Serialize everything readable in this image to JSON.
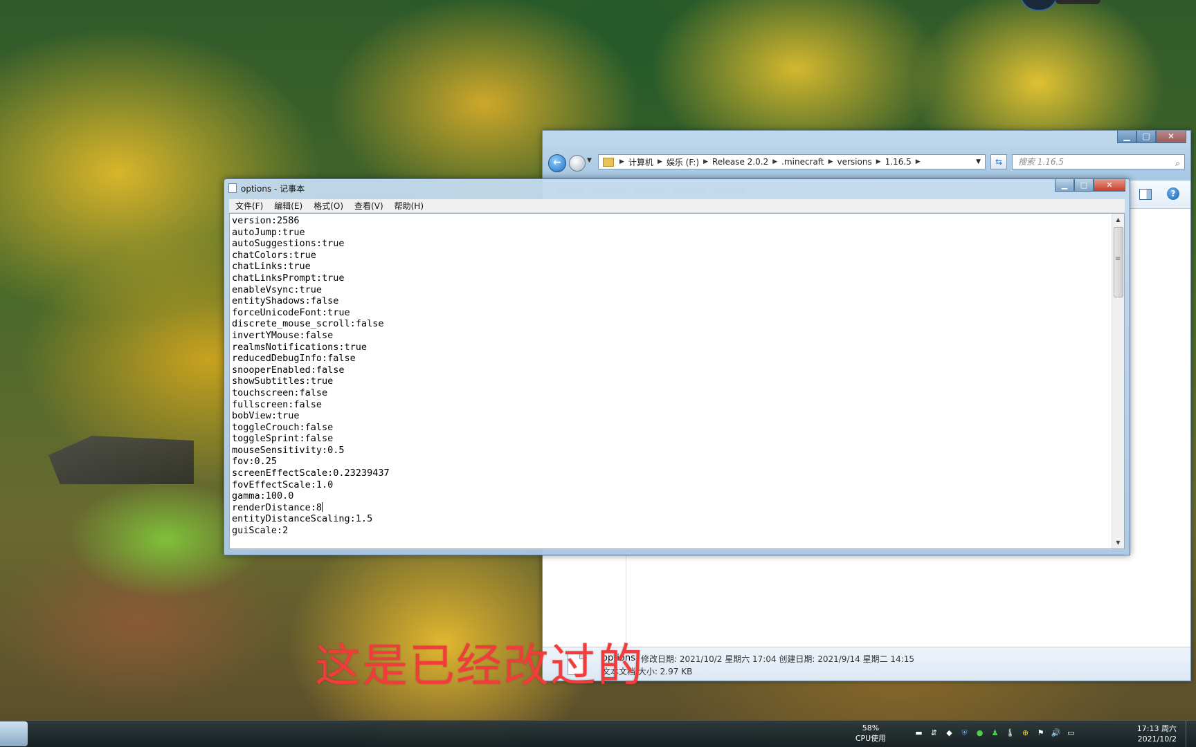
{
  "explorer": {
    "window_controls": {
      "minimize": "▁",
      "maximize": "□",
      "close": "✕"
    },
    "breadcrumb": [
      "计算机",
      "娱乐 (F:)",
      "Release 2.0.2",
      ".minecraft",
      "versions",
      "1.16.5"
    ],
    "search_placeholder": "搜索 1.16.5",
    "details": {
      "filename": "options",
      "modified": "修改日期: 2021/10/2 星期六 17:04 创建日期: 2021/9/14 星期二 14:15",
      "type_size": "文本文档    大小: 2.97 KB"
    }
  },
  "notepad": {
    "title": "options - 记事本",
    "window_controls": {
      "minimize": "▁",
      "maximize": "□",
      "close": "✕"
    },
    "menu": [
      "文件(F)",
      "编辑(E)",
      "格式(O)",
      "查看(V)",
      "帮助(H)"
    ],
    "lines": [
      "version:2586",
      "autoJump:true",
      "autoSuggestions:true",
      "chatColors:true",
      "chatLinks:true",
      "chatLinksPrompt:true",
      "enableVsync:true",
      "entityShadows:false",
      "forceUnicodeFont:true",
      "discrete_mouse_scroll:false",
      "invertYMouse:false",
      "realmsNotifications:true",
      "reducedDebugInfo:false",
      "snooperEnabled:false",
      "showSubtitles:true",
      "touchscreen:false",
      "fullscreen:false",
      "bobView:true",
      "toggleCrouch:false",
      "toggleSprint:false",
      "mouseSensitivity:0.5",
      "fov:0.25",
      "screenEffectScale:0.23239437",
      "fovEffectScale:1.0",
      "gamma:100.0",
      "renderDistance:8",
      "entityDistanceScaling:1.5",
      "guiScale:2"
    ]
  },
  "caption": "这是已经改过的",
  "taskbar": {
    "cpu_percent": "58%",
    "cpu_label": "CPU使用",
    "time": "17:13 周六",
    "date": "2021/10/2"
  }
}
